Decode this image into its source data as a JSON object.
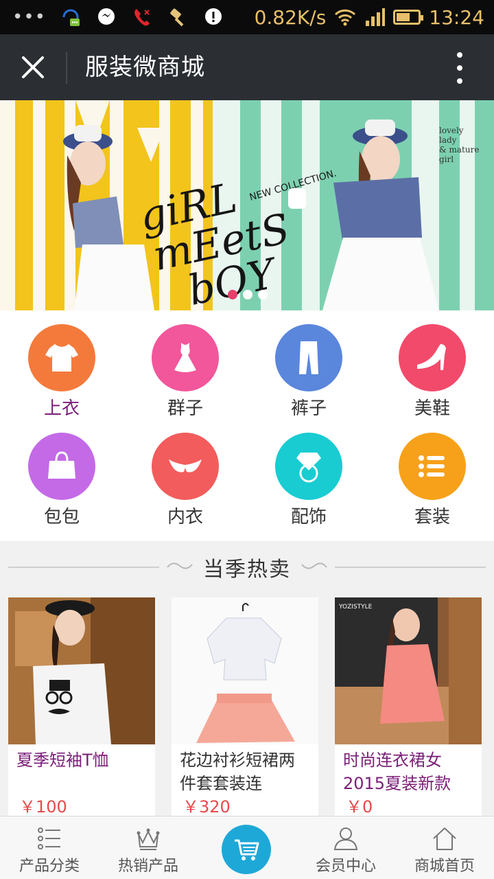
{
  "statusbar": {
    "dots": "•••",
    "net_speed": "0.82K/s",
    "time": "13:24",
    "icons": [
      "headset-chat-icon",
      "chat-bubble-icon",
      "missed-call-icon",
      "hammer-icon",
      "alert-icon",
      "wifi-icon",
      "signal-icon",
      "battery-icon"
    ]
  },
  "titlebar": {
    "title": "服装微商城",
    "close_icon": "close-icon",
    "more_icon": "more-vertical-icon"
  },
  "banner": {
    "headline": [
      "giRL",
      "mEetS",
      "bOY"
    ],
    "tag": "NEW COLLECTION.",
    "side_text": [
      "lovely",
      "lady",
      "& mature",
      "girl"
    ],
    "slides": 3,
    "active_slide": 1
  },
  "categories": [
    {
      "label": "上衣",
      "icon": "shirt-icon",
      "color": "#f47a3c",
      "active": true
    },
    {
      "label": "群子",
      "icon": "dress-icon",
      "color": "#f2569b",
      "active": false
    },
    {
      "label": "裤子",
      "icon": "pants-icon",
      "color": "#5a86dc",
      "active": false
    },
    {
      "label": "美鞋",
      "icon": "heel-shoe-icon",
      "color": "#f24a6a",
      "active": false
    },
    {
      "label": "包包",
      "icon": "handbag-icon",
      "color": "#c46ae6",
      "active": false
    },
    {
      "label": "内衣",
      "icon": "bra-icon",
      "color": "#f35c5c",
      "active": false
    },
    {
      "label": "配饰",
      "icon": "diamond-ring-icon",
      "color": "#18ccd2",
      "active": false
    },
    {
      "label": "套装",
      "icon": "list-icon",
      "color": "#f7a11a",
      "active": false
    }
  ],
  "hot": {
    "title": "当季热卖",
    "products": [
      {
        "name": "夏季短袖T恤",
        "price": "￥100"
      },
      {
        "name": "花边衬衫短裙两件套套装连",
        "price": "￥320"
      },
      {
        "name": "时尚连衣裙女2015夏装新款",
        "price": "￥0"
      }
    ],
    "tags": [
      "YOZISTYLE"
    ]
  },
  "bottomnav": {
    "items": [
      {
        "label": "产品分类",
        "icon": "category-list-icon"
      },
      {
        "label": "热销产品",
        "icon": "crown-icon"
      },
      {
        "label": "",
        "icon": "cart-icon"
      },
      {
        "label": "会员中心",
        "icon": "user-icon"
      },
      {
        "label": "商城首页",
        "icon": "home-icon"
      }
    ],
    "accent": "#1ea8d8"
  }
}
